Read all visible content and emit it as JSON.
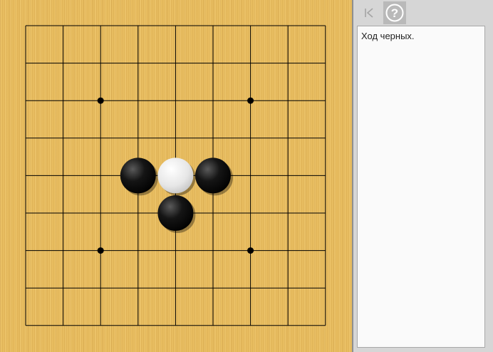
{
  "board": {
    "size": 9,
    "star_points": [
      [
        3,
        3
      ],
      [
        7,
        3
      ],
      [
        3,
        7
      ],
      [
        7,
        7
      ]
    ],
    "stones": [
      {
        "color": "black",
        "col": 4,
        "row": 5
      },
      {
        "color": "white",
        "col": 5,
        "row": 5
      },
      {
        "color": "black",
        "col": 6,
        "row": 5
      },
      {
        "color": "black",
        "col": 5,
        "row": 6
      }
    ],
    "colors": {
      "wood": "#e8bd60",
      "line": "#000000"
    }
  },
  "toolbar": {
    "back_icon": "first-move-icon",
    "help_icon": "help-circle-icon",
    "back_glyph": "|<",
    "help_glyph": "?"
  },
  "status": {
    "text": "Ход черных."
  }
}
